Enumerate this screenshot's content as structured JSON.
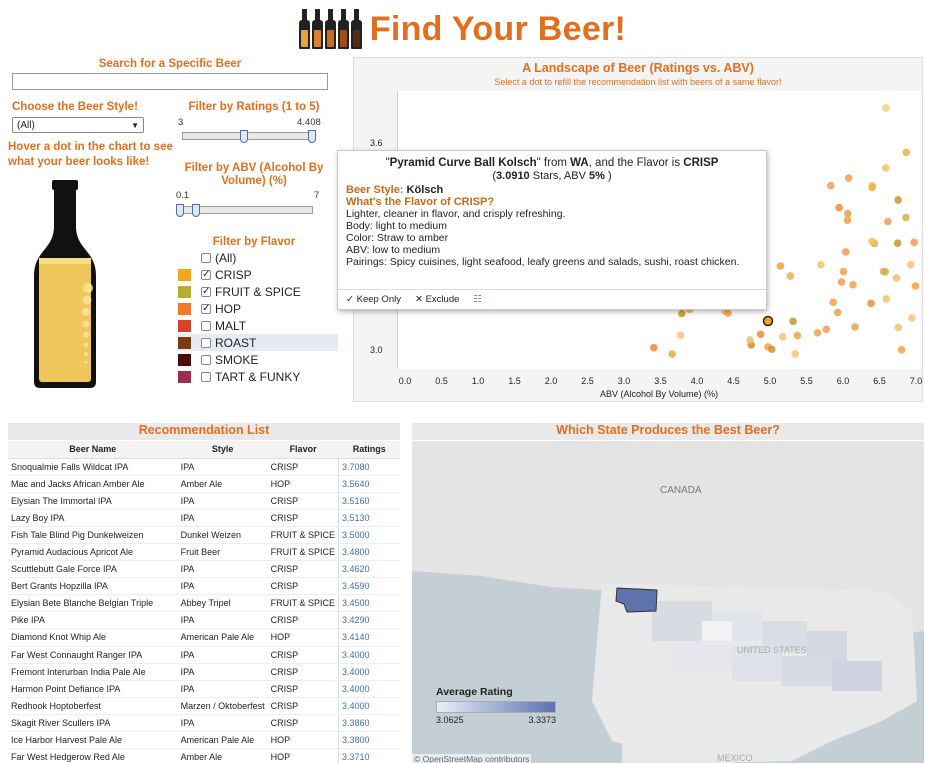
{
  "header": {
    "title": "Find Your Beer!",
    "bottle_colors": [
      "#e8a23a",
      "#d9822b",
      "#c96a1f",
      "#a04d16",
      "#5b2b0f"
    ]
  },
  "filters": {
    "search_label": "Search for a Specific Beer",
    "search_value": "",
    "style_label": "Choose the Beer Style!",
    "style_value": "(All)",
    "hover_text": "Hover a dot in the chart to see what your beer looks like!",
    "ratings_label": "Filter by Ratings (1 to 5)",
    "ratings_min": "3",
    "ratings_max": "4.408",
    "abv_label": "Filter by ABV (Alcohol By Volume) (%)",
    "abv_min": "0.1",
    "abv_max": "7",
    "flavor_label": "Filter by Flavor",
    "flavors": [
      {
        "label": "(All)",
        "checked": false,
        "color": ""
      },
      {
        "label": "CRISP",
        "checked": true,
        "color": "#f4a71d"
      },
      {
        "label": "FRUIT & SPICE",
        "checked": true,
        "color": "#b9ad2c"
      },
      {
        "label": "HOP",
        "checked": true,
        "color": "#f07a2b"
      },
      {
        "label": "MALT",
        "checked": false,
        "color": "#d9432e"
      },
      {
        "label": "ROAST",
        "checked": false,
        "color": "#7b3a10"
      },
      {
        "label": "SMOKE",
        "checked": false,
        "color": "#4a0a0a"
      },
      {
        "label": "TART & FUNKY",
        "checked": false,
        "color": "#a02a52"
      }
    ]
  },
  "scatter": {
    "title": "A Landscape of Beer (Ratings vs. ABV)",
    "subtitle": "Select a dot to refill the recommendation list with beers of a same flavor!",
    "xlabel": "ABV (Alcohol By Volume) (%)",
    "xticks": [
      "0.0",
      "0.5",
      "1.0",
      "1.5",
      "2.0",
      "2.5",
      "3.0",
      "3.5",
      "4.0",
      "4.5",
      "5.0",
      "5.5",
      "6.0",
      "6.5",
      "7.0"
    ],
    "yticks": [
      "3.0",
      "3.6"
    ]
  },
  "tooltip": {
    "q1": "\"",
    "beer": "Pyramid Curve Ball Kolsch",
    "from": "\" from ",
    "state": "WA",
    "flavor_is": ", and the Flavor is ",
    "flavor": "CRISP",
    "open_paren": "(",
    "rating": "3.0910",
    "stars": " Stars, ABV ",
    "abv": "5%",
    "close_paren": " )",
    "style_lbl": "Beer Style: ",
    "style": "Kölsch",
    "what": "What's the Flavor of CRISP?",
    "desc": "Lighter, cleaner in flavor, and crisply refreshing.",
    "body": "Body: light to medium",
    "color": "Color: Straw to amber",
    "abvline": "ABV: low to medium",
    "pairings": "Pairings: Spicy cuisines, light seafood, leafy greens and salads, sushi, roast chicken.",
    "keep": "Keep Only",
    "exclude": "Exclude"
  },
  "rec": {
    "title": "Recommendation List",
    "cols": [
      "Beer Name",
      "Style",
      "Flavor",
      "Ratings"
    ],
    "rows": [
      [
        "Snoqualmie Falls Wildcat IPA",
        "IPA",
        "CRISP",
        "3.7080"
      ],
      [
        "Mac and Jacks African Amber Ale",
        "Amber Ale",
        "HOP",
        "3.5640"
      ],
      [
        "Elysian The Immortal IPA",
        "IPA",
        "CRISP",
        "3.5160"
      ],
      [
        "Lazy Boy IPA",
        "IPA",
        "CRISP",
        "3.5130"
      ],
      [
        "Fish Tale Blind Pig Dunkelweizen",
        "Dunkel Weizen",
        "FRUIT & SPICE",
        "3.5000"
      ],
      [
        "Pyramid Audacious Apricot Ale",
        "Fruit Beer",
        "FRUIT & SPICE",
        "3.4800"
      ],
      [
        "Scuttlebutt Gale Force IPA",
        "IPA",
        "CRISP",
        "3.4620"
      ],
      [
        "Bert Grants Hopzilla IPA",
        "IPA",
        "CRISP",
        "3.4590"
      ],
      [
        "Elysian Bete Blanche Belgian Triple",
        "Abbey Tripel",
        "FRUIT & SPICE",
        "3.4500"
      ],
      [
        "Pike IPA",
        "IPA",
        "CRISP",
        "3.4290"
      ],
      [
        "Diamond Knot Whip Ale",
        "American Pale Ale",
        "HOP",
        "3.4140"
      ],
      [
        "Far West Connaught Ranger IPA",
        "IPA",
        "CRISP",
        "3.4000"
      ],
      [
        "Fremont Interurban India Pale Ale",
        "IPA",
        "CRISP",
        "3.4000"
      ],
      [
        "Harmon Point Defiance IPA",
        "IPA",
        "CRISP",
        "3.4000"
      ],
      [
        "Redhook Hoptoberfest",
        "Marzen / Oktoberfest",
        "CRISP",
        "3.4000"
      ],
      [
        "Skagit River Scullers IPA",
        "IPA",
        "CRISP",
        "3.3860"
      ],
      [
        "Ice Harbor Harvest Pale Ale",
        "American Pale Ale",
        "HOP",
        "3.3800"
      ],
      [
        "Far West Hedgerow Red Ale",
        "Amber Ale",
        "HOP",
        "3.3710"
      ]
    ]
  },
  "map": {
    "title": "Which State Produces the Best Beer?",
    "canada": "CANADA",
    "us": "UNITED STATES",
    "mexico": "MEXICO",
    "legend_title": "Average Rating",
    "legend_min": "3.0625",
    "legend_max": "3.3373",
    "osm": "© OpenStreetMap contributors"
  }
}
